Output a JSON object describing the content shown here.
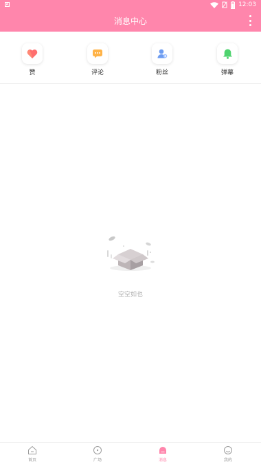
{
  "status_bar": {
    "time": "12:03",
    "app_badge": "A"
  },
  "header": {
    "title": "消息中心"
  },
  "quick_actions": [
    {
      "label": "赞",
      "icon": "heart-icon"
    },
    {
      "label": "评论",
      "icon": "comment-icon"
    },
    {
      "label": "粉丝",
      "icon": "fans-icon"
    },
    {
      "label": "弹幕",
      "icon": "bell-icon"
    }
  ],
  "empty_state": {
    "text": "空空如也",
    "icon": "empty-box-icon"
  },
  "bottom_nav": [
    {
      "label": "首页",
      "icon": "home-icon",
      "active": false
    },
    {
      "label": "广场",
      "icon": "plaza-icon",
      "active": false
    },
    {
      "label": "消息",
      "icon": "message-icon",
      "active": true
    },
    {
      "label": "我的",
      "icon": "profile-icon",
      "active": false
    }
  ],
  "colors": {
    "accent": "#ff86ac",
    "muted_text": "#b3b3b3"
  }
}
